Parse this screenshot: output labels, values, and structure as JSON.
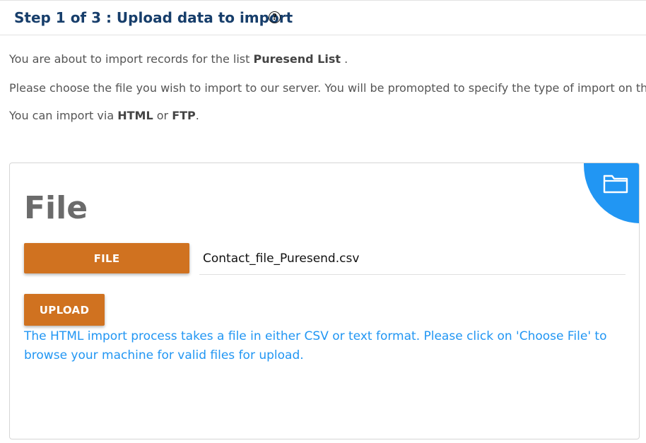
{
  "header": {
    "title": "Step 1 of 3 : Upload data to import",
    "help_symbol": "?"
  },
  "intro": {
    "line1_prefix": "You are about to import records for the list ",
    "list_name": "Puresend List",
    "line1_suffix": " .",
    "line2": "Please choose the file you wish to import to our server. You will be promopted to specify the type of import on the",
    "line3_prefix": "You can import via ",
    "method_html": "HTML",
    "line3_or": " or ",
    "method_ftp": "FTP",
    "line3_suffix": "."
  },
  "card": {
    "title": "File",
    "icon": "folder-icon",
    "file_button_label": "FILE",
    "file_value": "Contact_file_Puresend.csv",
    "upload_button_label": "UPLOAD",
    "help_text": "The HTML import process takes a file in either CSV or text format. Please click on 'Choose File' to browse your machine for valid files for upload."
  },
  "colors": {
    "title": "#173e6b",
    "button": "#d07220",
    "accent": "#2196f3",
    "text": "#555555"
  }
}
